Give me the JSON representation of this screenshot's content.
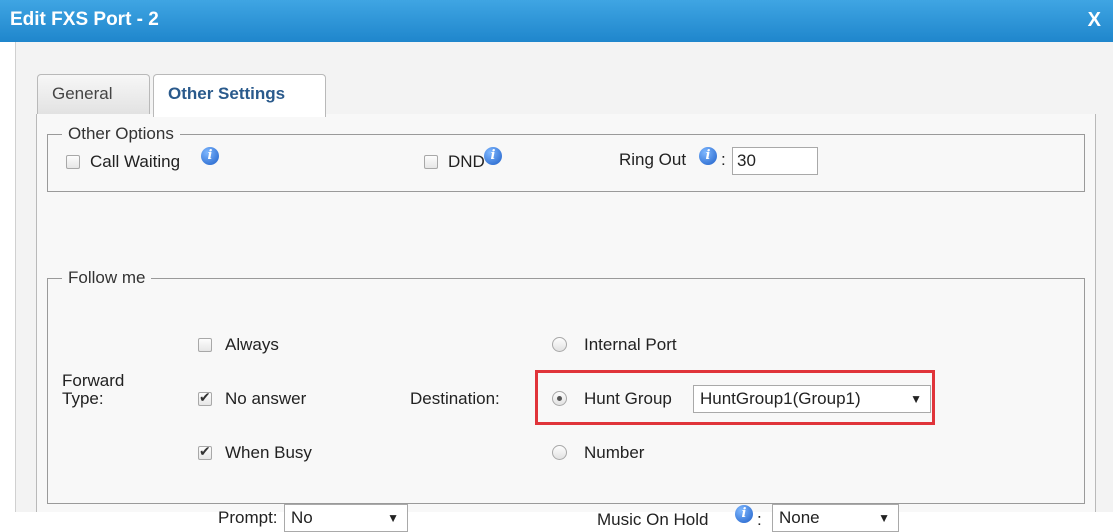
{
  "dialog": {
    "title": "Edit FXS Port - 2",
    "close_label": "X"
  },
  "tabs": [
    {
      "label": "General",
      "active": false
    },
    {
      "label": "Other Settings",
      "active": true
    }
  ],
  "other_options": {
    "legend": "Other Options",
    "call_waiting_label": "Call Waiting",
    "call_waiting_checked": false,
    "dnd_label": "DND",
    "dnd_checked": false,
    "ring_out_label": "Ring Out",
    "ring_out_colon": ":",
    "ring_out_value": "30"
  },
  "follow_me": {
    "legend": "Follow me",
    "forward_type_label": "Forward\nType:",
    "always_label": "Always",
    "always_checked": false,
    "no_answer_label": "No answer",
    "no_answer_checked": true,
    "when_busy_label": "When Busy",
    "when_busy_checked": true,
    "destination_label": "Destination:",
    "internal_port_label": "Internal Port",
    "hunt_group_label": "Hunt Group",
    "hunt_group_value": "HuntGroup1(Group1)",
    "number_label": "Number",
    "selected_destination": "Hunt Group",
    "prompt_label": "Prompt:",
    "prompt_value": "No",
    "music_on_hold_label": "Music On Hold",
    "music_on_hold_colon": ":",
    "music_on_hold_value": "None"
  },
  "icons": {
    "info": "info-icon",
    "dropdown": "▼"
  },
  "colors": {
    "titlebar": "#1f86cc",
    "highlight": "#e0343a",
    "active_tab_text": "#2a5a8c"
  }
}
